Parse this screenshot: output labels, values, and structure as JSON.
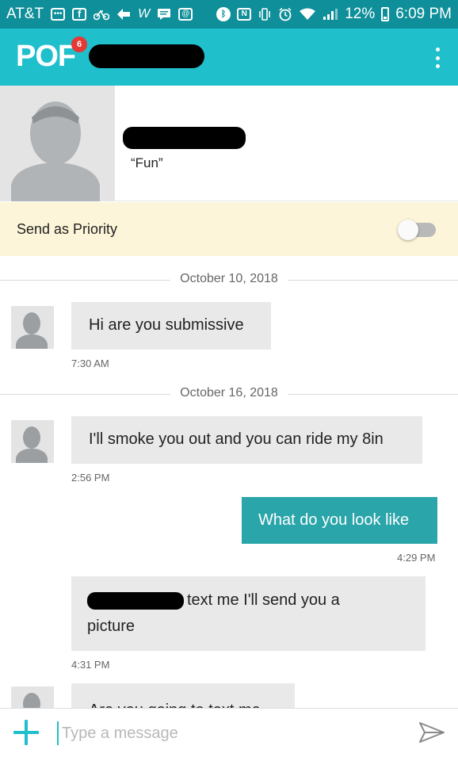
{
  "status_bar": {
    "carrier": "AT&T",
    "battery": "12%",
    "time": "6:09 PM",
    "icons": [
      "message-icon",
      "facebook-icon",
      "bike-icon",
      "navigation-icon",
      "w-icon",
      "chat-icon",
      "email-icon",
      "bluetooth-icon",
      "nfc-icon",
      "vibrate-icon",
      "alarm-icon",
      "wifi-icon",
      "signal-icon",
      "battery-icon"
    ]
  },
  "app_bar": {
    "logo": "POF",
    "notification_count": "6"
  },
  "profile": {
    "tagline": "“Fun”"
  },
  "priority": {
    "label": "Send as Priority",
    "enabled": false
  },
  "messages": {
    "date1": "October 10, 2018",
    "m1_text": "Hi are you submissive",
    "m1_time": "7:30 AM",
    "date2": "October 16, 2018",
    "m2_text": "I'll smoke you out and you can ride my 8in",
    "m2_time": "2:56 PM",
    "m3_text": "What do you look like",
    "m3_time": "4:29 PM",
    "m4_text_line1": "text me I'll send you a",
    "m4_text_line2": "picture",
    "m4_time": "4:31 PM",
    "m5_text": "Are you going to text me"
  },
  "compose": {
    "placeholder": "Type a message"
  },
  "colors": {
    "status_bar": "#0e8f99",
    "app_bar": "#1fbfcc",
    "outgoing_bubble": "#2aa5aa",
    "incoming_bubble": "#e9e9e9",
    "priority_bg": "#fdf5d9"
  }
}
